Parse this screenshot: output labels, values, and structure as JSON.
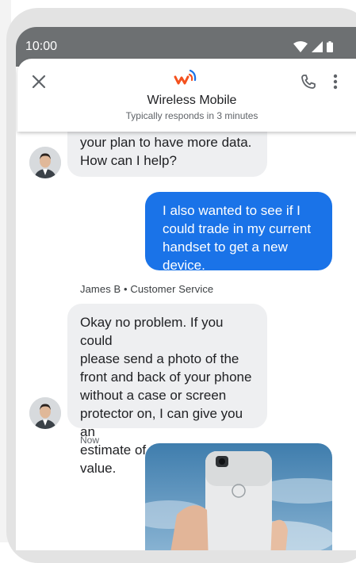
{
  "status_bar": {
    "time": "10:00"
  },
  "header": {
    "business_name": "Wireless Mobile",
    "response_time": "Typically responds in 3 minutes"
  },
  "messages": {
    "m1": {
      "line1": "your plan to have more data.",
      "line2": "How can I help?"
    },
    "m2": [
      "I also wanted to see if I",
      "could trade in my current",
      "handset to get a new",
      "device."
    ],
    "sender_label": "James B • Customer Service",
    "m3": [
      "Okay no problem. If you could",
      "please send a photo of the",
      "front and back of your phone",
      "without a case or screen",
      "protector on, I can give you an",
      "estimate of the trade-in value."
    ],
    "timestamp": "Now"
  },
  "colors": {
    "status_bar": "#6d7072",
    "outgoing_bubble": "#1a73e8",
    "incoming_bubble": "#eeeff1",
    "brand_orange": "#f4511e",
    "brand_blue": "#1a73e8"
  },
  "icons": {
    "close": "close-icon",
    "call": "phone-icon",
    "more": "more-vert-icon",
    "signal": "signal-icon",
    "wifi": "wifi-icon",
    "battery": "battery-icon"
  }
}
